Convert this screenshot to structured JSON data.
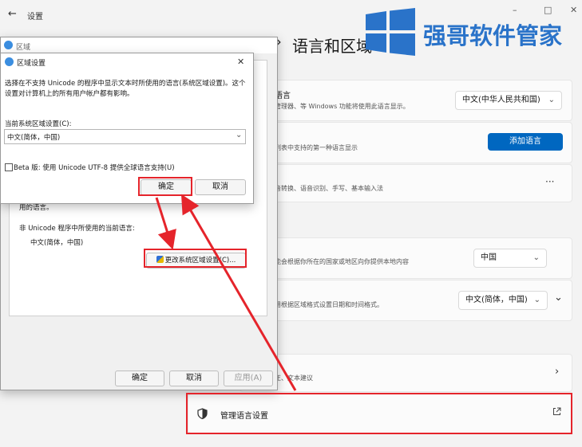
{
  "settings_window": {
    "back_icon": "arrow-left",
    "title": "设置",
    "minimize": "–",
    "maximize": "□",
    "close": "✕",
    "page_title": "语言和区域",
    "breadcrumb_sep": "›",
    "row1_title": "语言",
    "row1_desc": "管理器、等 Windows 功能将使用此语言显示。",
    "row1_value": "中文(中华人民共和国)",
    "row2_desc": "列表中支持的第一种语言显示",
    "row2_button": "添加语言",
    "row3_title": ")",
    "row3_desc": "音转换、语音识别、手写、基本输入法",
    "row3_more": "···",
    "row4_desc": "能会根据你所在的国家或地区向你提供本地内容",
    "row4_value": "中国",
    "row5_desc": "用根据区域格式设置日期和时间格式。",
    "row5_value": "中文(简体，中国)",
    "row6_desc": "正、文本建议",
    "row7_label": "管理语言设置"
  },
  "watermark": {
    "text": "强哥软件管家"
  },
  "region_dialog": {
    "title": "区域",
    "text1": "用的语言。",
    "label": "非 Unicode 程序中所使用的当前语言:",
    "value": "中文(简体，中国)",
    "change_button": "更改系统区域设置(C)...",
    "ok": "确定",
    "cancel": "取消",
    "apply": "应用(A)"
  },
  "region_settings_dialog": {
    "title": "区域设置",
    "close": "✕",
    "description": "选择在不支持 Unicode 的程序中显示文本时所使用的语言(系统区域设置)。这个设置对计算机上的所有用户帐户都有影响。",
    "current_label": "当前系统区域设置(C):",
    "current_value": "中文(简体，中国)",
    "beta_label": "Beta 版: 使用 Unicode UTF-8 提供全球语言支持(U)",
    "ok": "确定",
    "cancel": "取消"
  },
  "colors": {
    "accent": "#0067c0",
    "annotation": "#e5242b",
    "watermark": "#2a73c9"
  }
}
